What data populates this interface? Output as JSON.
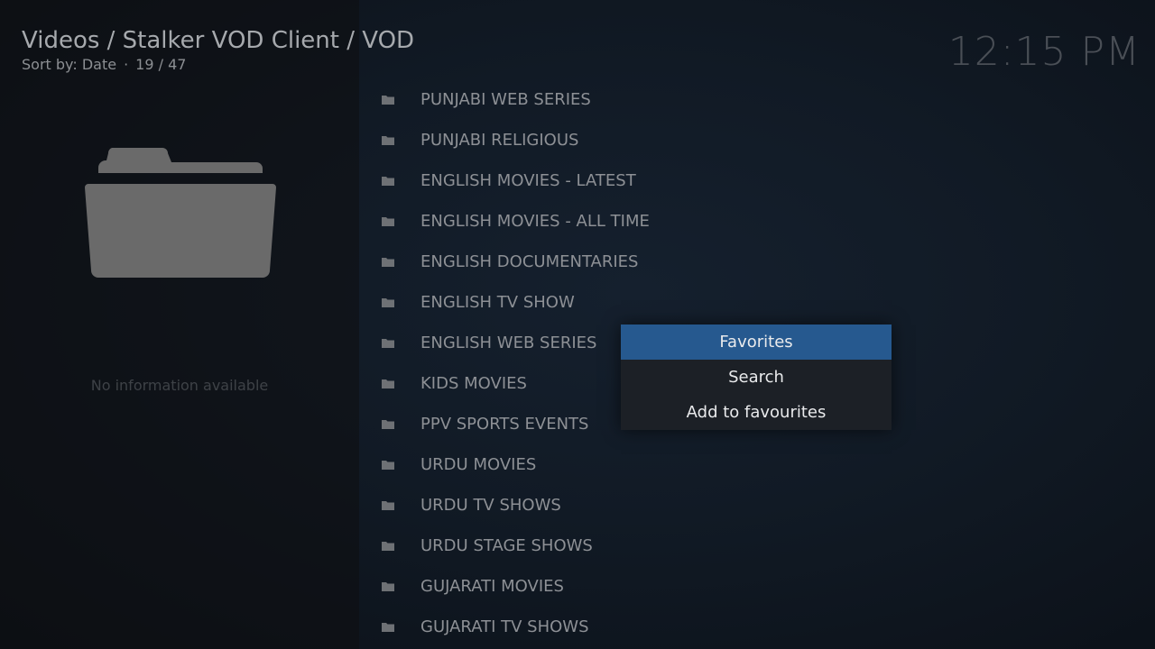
{
  "header": {
    "path": "Videos / Stalker VOD Client / VOD",
    "sort_label": "Sort by: Date",
    "separator": "·",
    "position": "19 / 47"
  },
  "clock": "12:15 PM",
  "info_panel": {
    "icon": "folder-icon",
    "message": "No information available"
  },
  "list": {
    "items": [
      {
        "label": "PUNJABI WEB SERIES"
      },
      {
        "label": "PUNJABI RELIGIOUS"
      },
      {
        "label": "ENGLISH MOVIES - LATEST"
      },
      {
        "label": "ENGLISH MOVIES - ALL TIME"
      },
      {
        "label": "ENGLISH DOCUMENTARIES"
      },
      {
        "label": "ENGLISH TV SHOW"
      },
      {
        "label": "ENGLISH WEB SERIES"
      },
      {
        "label": "KIDS MOVIES"
      },
      {
        "label": "PPV SPORTS EVENTS"
      },
      {
        "label": "URDU MOVIES"
      },
      {
        "label": "URDU TV SHOWS"
      },
      {
        "label": "URDU STAGE SHOWS"
      },
      {
        "label": "GUJARATI MOVIES"
      },
      {
        "label": "GUJARATI TV SHOWS"
      }
    ]
  },
  "context_menu": {
    "items": [
      {
        "label": "Favorites",
        "focused": true
      },
      {
        "label": "Search",
        "focused": false
      },
      {
        "label": "Add to favourites",
        "focused": false
      }
    ]
  },
  "colors": {
    "background": "#111a25",
    "focus": "#26598f",
    "menu_bg": "#1c2026",
    "text": "#8d9095"
  }
}
